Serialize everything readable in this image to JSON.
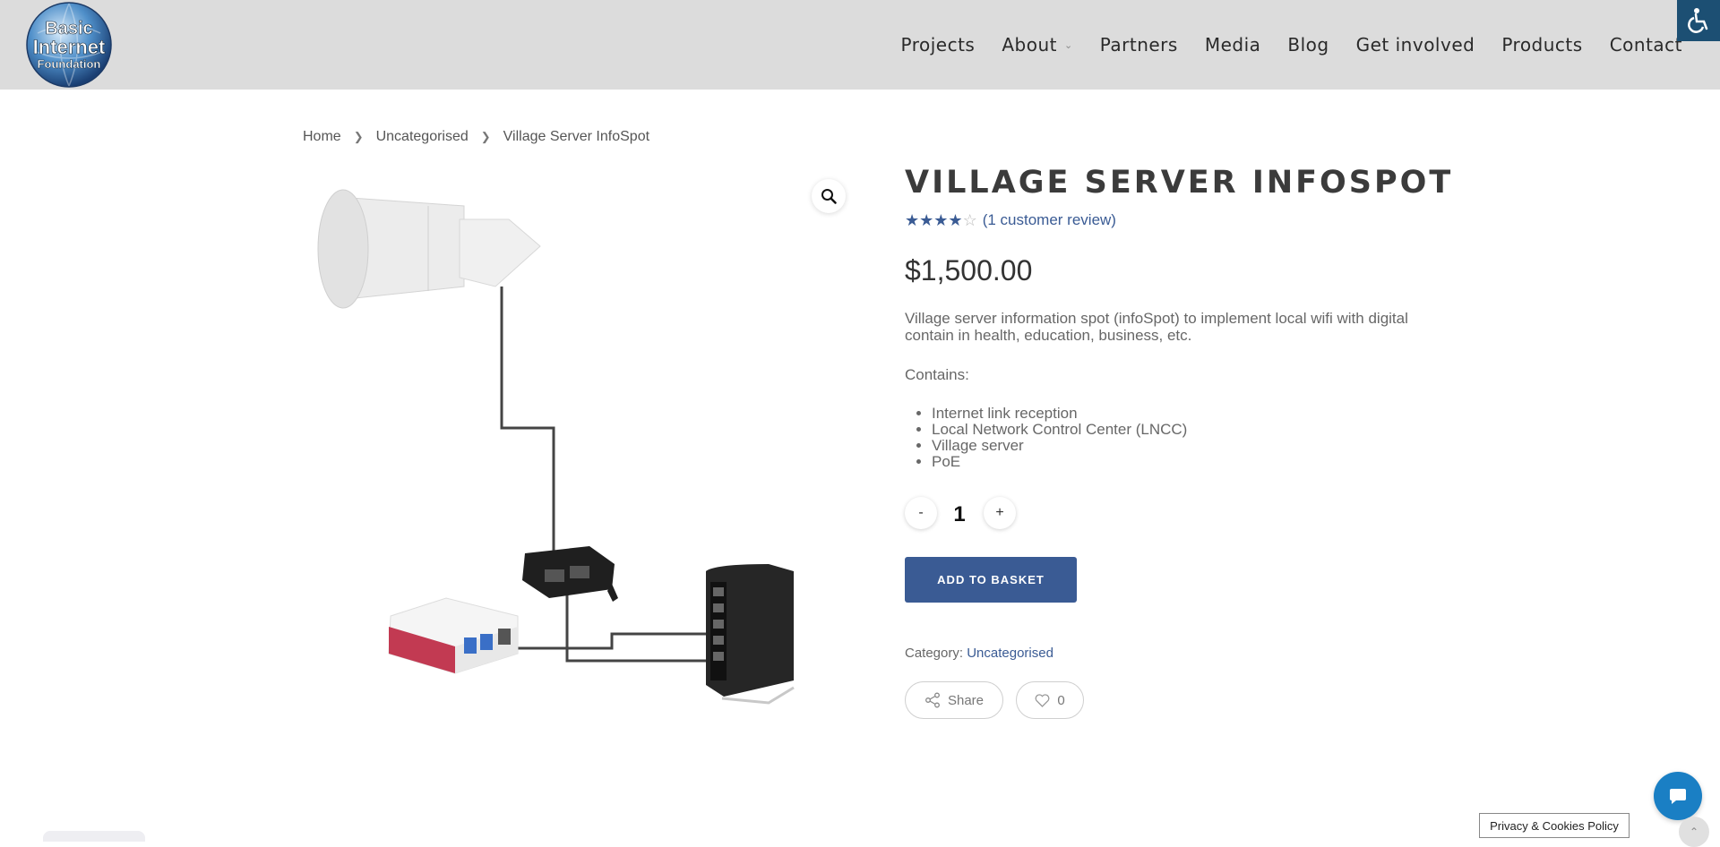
{
  "header": {
    "logo_text": [
      "Basic",
      "Internet",
      "Foundation"
    ],
    "nav": [
      {
        "label": "Projects"
      },
      {
        "label": "About",
        "has_dropdown": true
      },
      {
        "label": "Partners"
      },
      {
        "label": "Media"
      },
      {
        "label": "Blog"
      },
      {
        "label": "Get involved"
      },
      {
        "label": "Products"
      },
      {
        "label": "Contact"
      }
    ],
    "dropdown_icon": "chevron-down-icon",
    "accessibility_icon": "wheelchair-icon"
  },
  "breadcrumb": [
    "Home",
    "Uncategorised",
    "Village Server InfoSpot"
  ],
  "product": {
    "title": "Village Server InfoSpot",
    "rating": 4,
    "rating_max": 5,
    "review_link": "(1 customer review)",
    "price": "$1,500.00",
    "description": "Village server information spot (infoSpot) to implement local wifi with digital contain in health, education, business, etc.",
    "contains_label": "Contains:",
    "features": [
      "Internet link reception",
      "Local Network Control Center (LNCC)",
      "Village server",
      "PoE"
    ],
    "quantity": {
      "minus": "-",
      "value": "1",
      "plus": "+"
    },
    "add_to_basket": "Add to basket",
    "category_label": "Category:",
    "category_value": "Uncategorised",
    "share_label": "Share",
    "like_count": "0"
  },
  "footer": {
    "privacy_label": "Privacy & Cookies Policy"
  },
  "colors": {
    "header_bg": "#dcdcdc",
    "accent": "#3a5b94",
    "chat": "#1a7fc4",
    "accessibility": "#1c4f73"
  }
}
